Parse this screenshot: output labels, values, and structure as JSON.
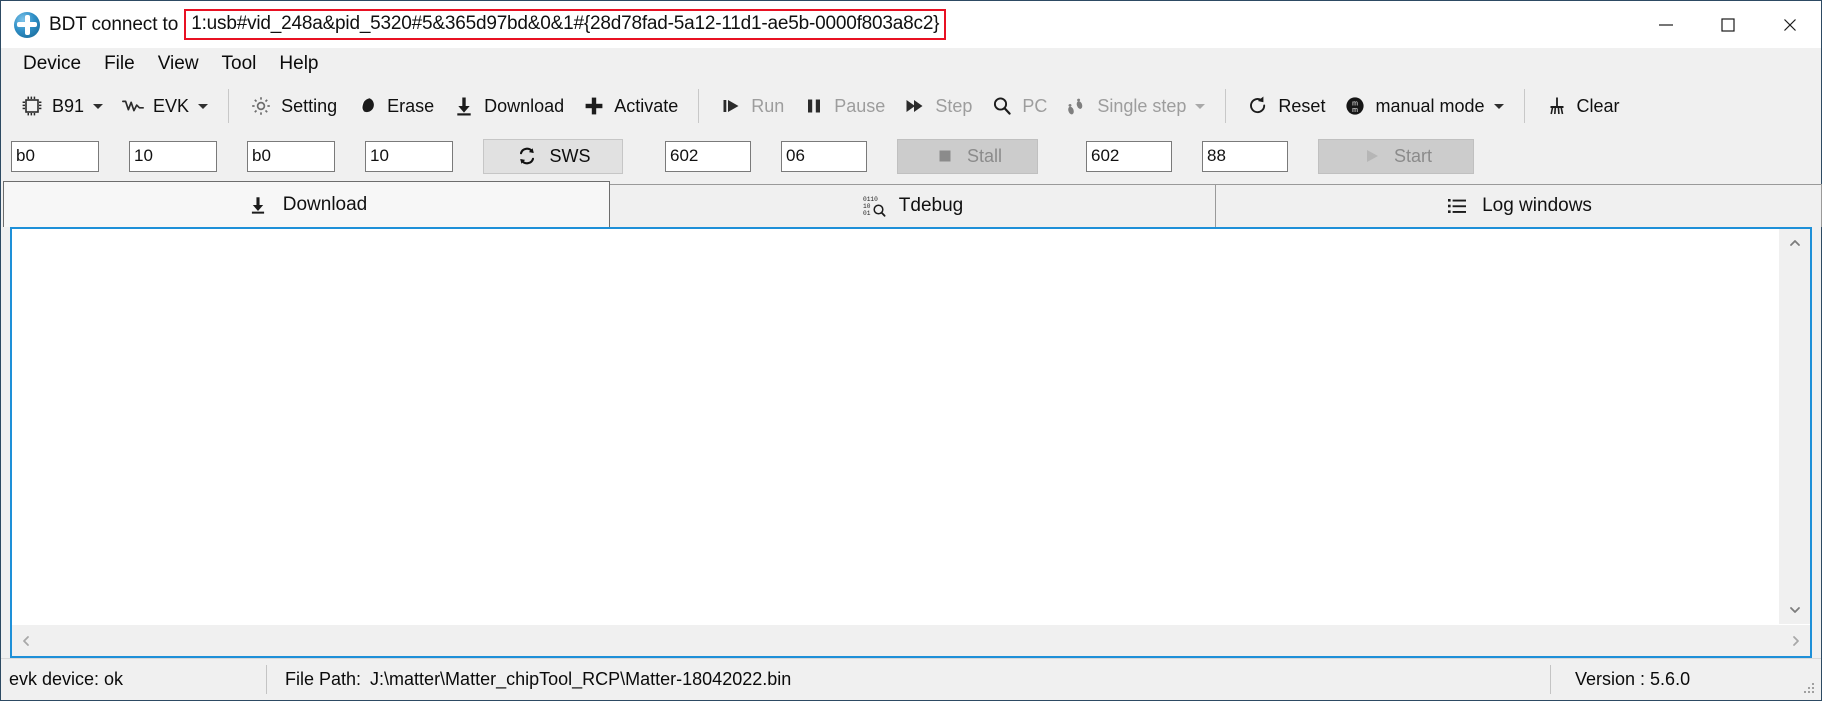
{
  "window": {
    "title_prefix": "BDT connect to",
    "title_highlight": "1:usb#vid_248a&pid_5320#5&365d97bd&0&1#{28d78fad-5a12-11d1-ae5b-0000f803a8c2}",
    "highlight_color": "#e81123",
    "minimize_label": "─",
    "maximize_label": "□",
    "close_label": "✕"
  },
  "menu": {
    "items": [
      {
        "label": "Device"
      },
      {
        "label": "File"
      },
      {
        "label": "View"
      },
      {
        "label": "Tool"
      },
      {
        "label": "Help"
      }
    ]
  },
  "toolbar": {
    "chip_label": "B91",
    "evk_label": "EVK",
    "setting_label": "Setting",
    "erase_label": "Erase",
    "download_label": "Download",
    "activate_label": "Activate",
    "run_label": "Run",
    "pause_label": "Pause",
    "step_label": "Step",
    "pc_label": "PC",
    "single_step_label": "Single step",
    "reset_label": "Reset",
    "manual_mode_label": "manual mode",
    "clear_label": "Clear"
  },
  "inputs": {
    "field1": "b0",
    "field2": "10",
    "field3": "b0",
    "field4": "10",
    "sws_label": "SWS",
    "field5": "602",
    "field6": "06",
    "stall_label": "Stall",
    "field7": "602",
    "field8": "88",
    "start_label": "Start"
  },
  "tabs": [
    {
      "label": "Download",
      "active": true
    },
    {
      "label": "Tdebug",
      "active": false
    },
    {
      "label": "Log windows",
      "active": false
    }
  ],
  "content": {
    "text": ""
  },
  "statusbar": {
    "device_status": "evk device: ok",
    "file_path_label": "File Path:",
    "file_path_value": "J:\\matter\\Matter_chipTool_RCP\\Matter-18042022.bin",
    "version": "Version : 5.6.0"
  }
}
